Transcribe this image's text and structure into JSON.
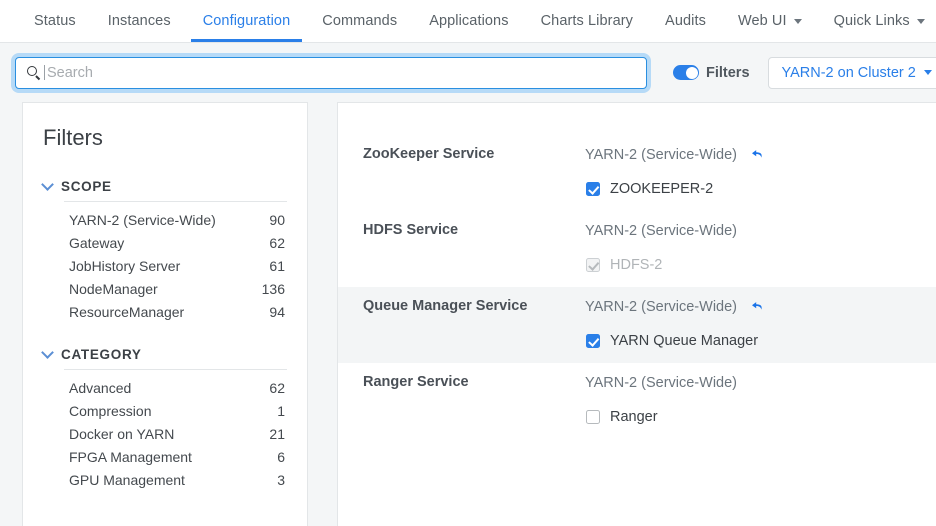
{
  "topnav": {
    "tabs": [
      {
        "label": "Status",
        "active": false,
        "dropdown": false
      },
      {
        "label": "Instances",
        "active": false,
        "dropdown": false
      },
      {
        "label": "Configuration",
        "active": true,
        "dropdown": false
      },
      {
        "label": "Commands",
        "active": false,
        "dropdown": false
      },
      {
        "label": "Applications",
        "active": false,
        "dropdown": false
      },
      {
        "label": "Charts Library",
        "active": false,
        "dropdown": false
      },
      {
        "label": "Audits",
        "active": false,
        "dropdown": false
      },
      {
        "label": "Web UI",
        "active": false,
        "dropdown": true
      },
      {
        "label": "Quick Links",
        "active": false,
        "dropdown": true
      }
    ]
  },
  "search": {
    "placeholder": "Search",
    "value": "",
    "icon": "search-icon"
  },
  "filters_toggle": {
    "label": "Filters",
    "enabled": true
  },
  "cluster_selector": {
    "label": "YARN-2 on Cluster 2",
    "icon": "chevron-down-icon"
  },
  "sidebar": {
    "title": "Filters",
    "groups": [
      {
        "title": "SCOPE",
        "expanded": true,
        "items": [
          {
            "label": "YARN-2 (Service-Wide)",
            "count": "90"
          },
          {
            "label": "Gateway",
            "count": "62"
          },
          {
            "label": "JobHistory Server",
            "count": "61"
          },
          {
            "label": "NodeManager",
            "count": "136"
          },
          {
            "label": "ResourceManager",
            "count": "94"
          }
        ]
      },
      {
        "title": "CATEGORY",
        "expanded": true,
        "items": [
          {
            "label": "Advanced",
            "count": "62"
          },
          {
            "label": "Compression",
            "count": "1"
          },
          {
            "label": "Docker on YARN",
            "count": "21"
          },
          {
            "label": "FPGA Management",
            "count": "6"
          },
          {
            "label": "GPU Management",
            "count": "3"
          }
        ]
      }
    ]
  },
  "content": {
    "rows": [
      {
        "label": "ZooKeeper Service",
        "scope": "YARN-2 (Service-Wide)",
        "has_undo": true,
        "highlight": false,
        "checkbox": {
          "label": "ZOOKEEPER-2",
          "state": "checked"
        }
      },
      {
        "label": "HDFS Service",
        "scope": "YARN-2 (Service-Wide)",
        "has_undo": false,
        "highlight": false,
        "checkbox": {
          "label": "HDFS-2",
          "state": "disabled"
        }
      },
      {
        "label": "Queue Manager Service",
        "scope": "YARN-2 (Service-Wide)",
        "has_undo": true,
        "highlight": true,
        "checkbox": {
          "label": "YARN Queue Manager",
          "state": "checked"
        }
      },
      {
        "label": "Ranger Service",
        "scope": "YARN-2 (Service-Wide)",
        "has_undo": false,
        "highlight": false,
        "checkbox": {
          "label": "Ranger",
          "state": "unchecked"
        }
      }
    ]
  },
  "colors": {
    "accent": "#2a7fe8",
    "page_bg": "#f4f6f7",
    "panel_bg": "#ffffff",
    "row_highlight": "#f3f5f6",
    "border": "#e3e6e8",
    "muted_text": "#6c757d"
  }
}
